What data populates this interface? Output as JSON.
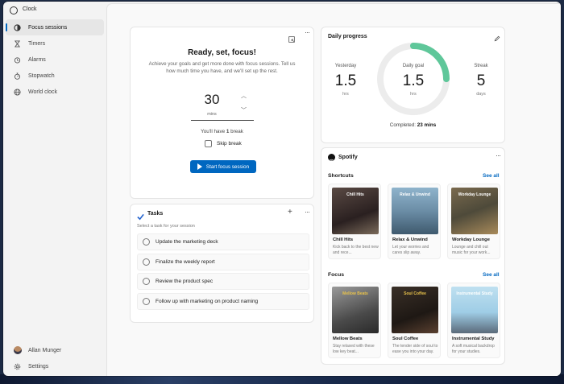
{
  "app": {
    "title": "Clock",
    "controls": {
      "minimize": "—",
      "maximize": "□",
      "close": "✕"
    }
  },
  "sidebar": {
    "items": [
      {
        "label": "Focus sessions",
        "icon": "focus-icon",
        "active": true
      },
      {
        "label": "Timers",
        "icon": "timer-icon"
      },
      {
        "label": "Alarms",
        "icon": "alarm-icon"
      },
      {
        "label": "Stopwatch",
        "icon": "stopwatch-icon"
      },
      {
        "label": "World clock",
        "icon": "globe-icon"
      }
    ],
    "user": "Allan Munger",
    "settings": "Settings"
  },
  "focus": {
    "heading": "Ready, set, focus!",
    "subtitle": "Achieve your goals and get more done with focus sessions. Tell us how much time you have, and we'll set up the rest.",
    "minutes_value": "30",
    "minutes_unit": "mins",
    "break_prefix": "You'll have ",
    "break_count": "1",
    "break_suffix": " break",
    "skip_break": "Skip break",
    "start_label": "Start focus session"
  },
  "tasks": {
    "title": "Tasks",
    "hint": "Select a task for your session",
    "items": [
      "Update the marketing deck",
      "Finalize the weekly report",
      "Review the product spec",
      "Follow up with marketing on product naming"
    ]
  },
  "daily_progress": {
    "title": "Daily progress",
    "yesterday": {
      "label": "Yesterday",
      "value": "1.5",
      "unit": "hrs"
    },
    "goal": {
      "label": "Daily goal",
      "value": "1.5",
      "unit": "hrs",
      "progress": 0.25
    },
    "streak": {
      "label": "Streak",
      "value": "5",
      "unit": "days"
    },
    "completed_label": "Completed: ",
    "completed_value": "23 mins",
    "accent": "#5fc79a"
  },
  "spotify": {
    "title": "Spotify",
    "shortcuts": {
      "title": "Shortcuts",
      "see_all": "See all",
      "albums": [
        {
          "art_text": "Chill Hits",
          "name": "Chill Hits",
          "desc": "Kick back to the best new and rece..."
        },
        {
          "art_text": "Relax & Unwind",
          "name": "Relax & Unwind",
          "desc": "Let your worries and cares slip away."
        },
        {
          "art_text": "Workday Lounge",
          "name": "Workday Lounge",
          "desc": "Lounge and chill out music for your work..."
        }
      ]
    },
    "focus": {
      "title": "Focus",
      "see_all": "See all",
      "albums": [
        {
          "art_text": "Mellow Beats",
          "name": "Mellow Beats",
          "desc": "Stay relaxed with these low key beat..."
        },
        {
          "art_text": "Soul Coffee",
          "name": "Soul Coffee",
          "desc": "The tender side of soul to ease you into your day."
        },
        {
          "art_text": "Instrumental Study",
          "name": "Instrumental Study",
          "desc": "A soft musical backdrop for your studies."
        }
      ]
    }
  }
}
